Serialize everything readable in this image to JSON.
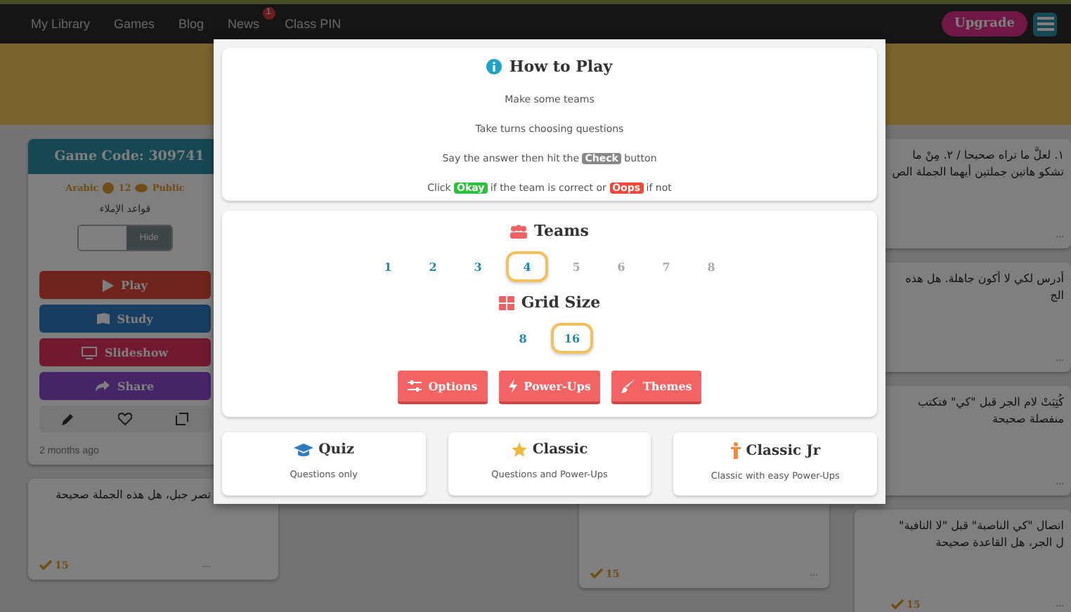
{
  "nav": {
    "items": [
      {
        "label": "My Library"
      },
      {
        "label": "Games"
      },
      {
        "label": "Blog"
      },
      {
        "label": "News",
        "badge": "1"
      },
      {
        "label": "Class PIN"
      }
    ],
    "upgrade": "Upgrade"
  },
  "game_card": {
    "code": "Game Code: 309741",
    "language": "Arabic",
    "questions": "12",
    "visibility": "Public",
    "subtitle": "قواعد الإملاء",
    "toggle": {
      "label": "Hide",
      "on": false
    },
    "actions": [
      {
        "label": "Play",
        "kind": "play"
      },
      {
        "label": "Study",
        "kind": "study"
      },
      {
        "label": "Slideshow",
        "kind": "slideshow"
      },
      {
        "label": "Share",
        "kind": "share"
      }
    ],
    "updated": "2 months ago"
  },
  "left_cards": [
    {
      "text": "تصر جبل، هل هذه الجملة صحيحة",
      "count": "15",
      "more": "..."
    }
  ],
  "middle_cards": [
    {
      "count": "15",
      "more": "..."
    }
  ],
  "right_cards": [
    {
      "text": "١. لعلَّ ما تراه صحيحا / ٢. مِنْ ما تشكو هاتين جملتين أيهما الجملة الص",
      "more": "..."
    },
    {
      "text": "أدرس لكي لا أكون جاهلة. هل هذه الج",
      "more": "..."
    },
    {
      "text": "كُتِبَتْ لام الجر قبل \"كي\" فتكتب منفصلة صحيحة",
      "more": "..."
    },
    {
      "text": "اتصال \"كي الناصبة\" قبل \"لا النافية\" ل الجر، هل القاعدة صحيحة",
      "count": "15",
      "more": "..."
    }
  ],
  "how_to_play": {
    "title": "How to Play",
    "steps": [
      [
        {
          "text": "Make some teams"
        }
      ],
      [
        {
          "text": "Take turns choosing questions"
        }
      ],
      [
        {
          "text": "Say the answer then hit the "
        },
        {
          "tag": "Check",
          "kind": "check"
        },
        {
          "text": " button"
        }
      ],
      [
        {
          "text": "Click "
        },
        {
          "tag": "Okay",
          "kind": "okay"
        },
        {
          "text": " if the team is correct or "
        },
        {
          "tag": "Oops",
          "kind": "oops"
        },
        {
          "text": " if not"
        }
      ]
    ]
  },
  "teams": {
    "title": "Teams",
    "options": [
      {
        "label": "1",
        "selected": false,
        "disabled": false
      },
      {
        "label": "2",
        "selected": false,
        "disabled": false
      },
      {
        "label": "3",
        "selected": false,
        "disabled": false
      },
      {
        "label": "4",
        "selected": true,
        "disabled": false
      },
      {
        "label": "5",
        "selected": false,
        "disabled": true
      },
      {
        "label": "6",
        "selected": false,
        "disabled": true
      },
      {
        "label": "7",
        "selected": false,
        "disabled": true
      },
      {
        "label": "8",
        "selected": false,
        "disabled": true
      }
    ]
  },
  "grid_size": {
    "title": "Grid Size",
    "options": [
      {
        "label": "8",
        "selected": false
      },
      {
        "label": "16",
        "selected": true
      }
    ]
  },
  "settings_buttons": [
    {
      "label": "Options",
      "kind": "options"
    },
    {
      "label": "Power-Ups",
      "kind": "powerups"
    },
    {
      "label": "Themes",
      "kind": "themes"
    }
  ],
  "modes": [
    {
      "title": "Quiz",
      "description": "Questions only",
      "kind": "quiz"
    },
    {
      "title": "Classic",
      "description": "Questions and Power-Ups",
      "kind": "classic"
    },
    {
      "title": "Classic Jr",
      "description": "Classic with easy Power-Ups",
      "kind": "classicjr"
    }
  ]
}
